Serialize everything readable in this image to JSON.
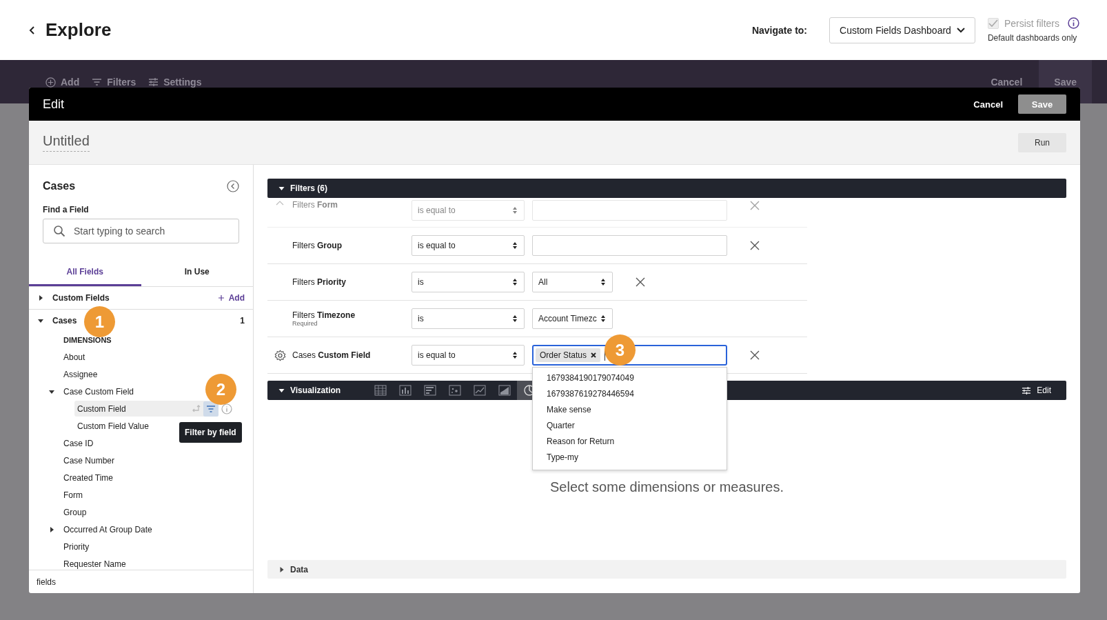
{
  "header": {
    "title": "Explore",
    "navigate_label": "Navigate to:",
    "navigate_value": "Custom Fields Dashboard",
    "persist": {
      "label": "Persist filters",
      "checked": true,
      "disabled": true
    },
    "persist_note": "Default dashboards only"
  },
  "toolbar": {
    "items": [
      {
        "kind": "add",
        "label": "Add"
      },
      {
        "kind": "filters",
        "label": "Filters"
      },
      {
        "kind": "settings",
        "label": "Settings"
      }
    ],
    "cancel": "Cancel",
    "save": "Save"
  },
  "modal": {
    "title": "Edit",
    "cancel": "Cancel",
    "save": "Save",
    "name": "Untitled",
    "run": "Run"
  },
  "sidebar": {
    "title": "Cases",
    "search_label": "Find a Field",
    "search": {
      "placeholder": "Start typing to search"
    },
    "tabs": [
      {
        "label": "All Fields",
        "selected": true
      },
      {
        "label": "In Use",
        "selected": false
      }
    ],
    "tree": [
      {
        "label": "Custom Fields",
        "expanded": false,
        "add_label": "Add"
      },
      {
        "label": "Cases",
        "expanded": true,
        "count": "1",
        "children": [
          {
            "label": "DIMENSIONS",
            "kind": "heading"
          },
          {
            "label": "About"
          },
          {
            "label": "Assignee"
          },
          {
            "label": "Case Custom Field",
            "expanded": true,
            "children": [
              {
                "label": "Custom Field",
                "highlighted": true
              },
              {
                "label": "Custom Field Value"
              }
            ]
          },
          {
            "label": "Case ID"
          },
          {
            "label": "Case Number"
          },
          {
            "label": "Created Time"
          },
          {
            "label": "Form"
          },
          {
            "label": "Group"
          },
          {
            "label": "Occurred At Group Date",
            "expanded": false
          },
          {
            "label": "Priority"
          },
          {
            "label": "Requester Name"
          }
        ]
      }
    ],
    "footer": "fields"
  },
  "filters": {
    "title": "Filters (6)",
    "expanded": true,
    "rows": [
      {
        "label": "Filters **Form**",
        "faded": true,
        "operator": "is equal to",
        "kind": "text",
        "removable": true
      },
      {
        "label": "Filters **Group**",
        "operator": "is equal to",
        "kind": "text",
        "removable": true
      },
      {
        "label": "Filters **Priority**",
        "operator": "is",
        "kind": "select",
        "value": "All",
        "removable": true
      },
      {
        "label": "Filters **Timezone**",
        "note": "Required",
        "operator": "is",
        "kind": "select",
        "value": "Account Timezc",
        "removable": false
      },
      {
        "label": "Cases **Custom Field**",
        "gear": true,
        "operator": "is equal to",
        "kind": "tags",
        "tags": [
          "Order Status"
        ],
        "focused": true,
        "removable": true,
        "options": [
          "1679384190179074049",
          "1679387619278446594",
          "Make sense",
          "Quarter",
          "Reason for Return",
          "Type-my"
        ]
      }
    ]
  },
  "visualization": {
    "title": "Visualization",
    "types": [
      {
        "kind": "table",
        "selected": false
      },
      {
        "kind": "column",
        "selected": false
      },
      {
        "kind": "bar",
        "selected": false
      },
      {
        "kind": "scatter",
        "selected": false
      },
      {
        "kind": "line",
        "selected": false
      },
      {
        "kind": "area",
        "selected": false
      },
      {
        "kind": "pie",
        "selected": true
      }
    ],
    "edit": "Edit",
    "empty_message": "Select some dimensions or measures."
  },
  "data_section": {
    "title": "Data",
    "expanded": false
  },
  "tooltip": "Filter by field",
  "markers": [
    {
      "label": "1"
    },
    {
      "label": "2"
    },
    {
      "label": "3"
    }
  ]
}
